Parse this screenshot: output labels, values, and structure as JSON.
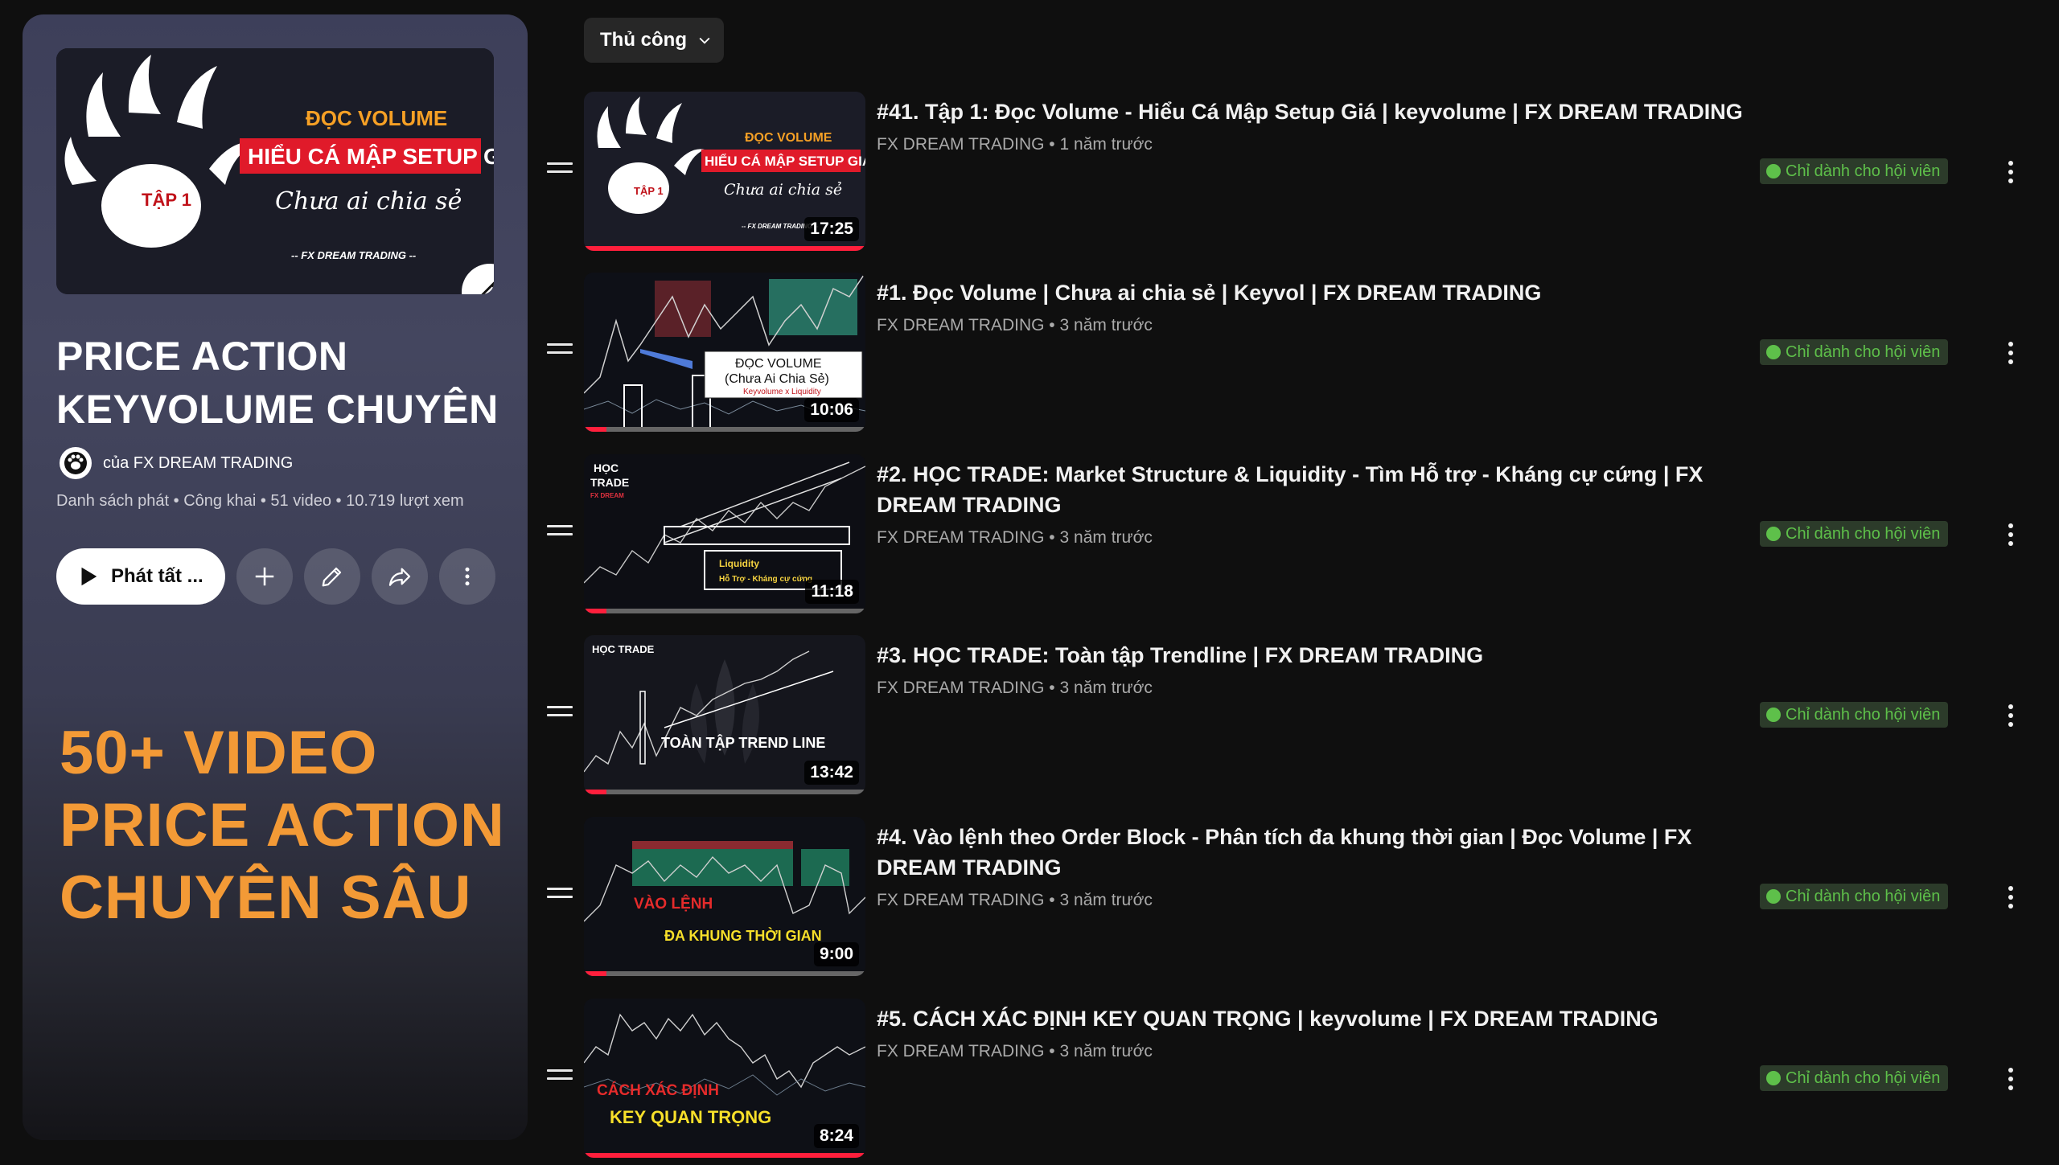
{
  "playlist": {
    "cover": {
      "line1": "ĐỌC VOLUME",
      "line2": "HIỂU CÁ MẬP SETUP GIÁ",
      "line3": "Chưa ai chia sẻ",
      "episode": "TẬP 1",
      "brand": "-- FX DREAM TRADING --"
    },
    "title_line1": "PRICE ACTION",
    "title_line2": "KEYVOLUME CHUYÊN ...",
    "owner": "của FX DREAM TRADING",
    "meta": "Danh sách phát • Công khai • 51 video • 10.719 lượt xem",
    "play_all_label": "Phát tất ...",
    "promo": [
      "50+ VIDEO",
      "PRICE ACTION",
      "CHUYÊN SÂU"
    ]
  },
  "sort": {
    "label": "Thủ công"
  },
  "videos": [
    {
      "title": "#41. Tập 1: Đọc Volume - Hiểu Cá Mập Setup Giá | keyvolume | FX DREAM TRADING",
      "channel": "FX DREAM TRADING",
      "age": "1 năm trước",
      "duration": "17:25",
      "badge": "Chỉ dành cho hội viên",
      "progress": 1.0,
      "thumb_texts": [
        "ĐỌC VOLUME",
        "HIỂU CÁ MẬP SETUP GIÁ",
        "Chưa ai chia sẻ",
        "TẬP 1",
        "-- FX DREAM TRADING --"
      ]
    },
    {
      "title": "#1. Đọc Volume | Chưa ai chia sẻ | Keyvol | FX DREAM TRADING",
      "channel": "FX DREAM TRADING",
      "age": "3 năm trước",
      "duration": "10:06",
      "badge": "Chỉ dành cho hội viên",
      "progress": 0.08,
      "thumb_texts": [
        "ĐỌC VOLUME",
        "(Chưa Ai Chia Sẻ)",
        "Keyvolume x Liquidity"
      ]
    },
    {
      "title": "#2. HỌC TRADE: Market Structure & Liquidity - Tìm Hỗ trợ - Kháng cự cứng | FX DREAM TRADING",
      "channel": "FX DREAM TRADING",
      "age": "3 năm trước",
      "duration": "11:18",
      "badge": "Chỉ dành cho hội viên",
      "progress": 0.08,
      "thumb_texts": [
        "HỌC",
        "TRADE",
        "FX DREAM",
        "Liquidity",
        "Hỗ Trợ - Kháng cự cứng"
      ]
    },
    {
      "title": "#3. HỌC TRADE: Toàn tập Trendline | FX DREAM TRADING",
      "channel": "FX DREAM TRADING",
      "age": "3 năm trước",
      "duration": "13:42",
      "badge": "Chỉ dành cho hội viên",
      "progress": 0.08,
      "thumb_texts": [
        "HỌC TRADE",
        "TOÀN TẬP TREND LINE"
      ]
    },
    {
      "title": "#4. Vào lệnh theo Order Block - Phân tích đa khung thời gian | Đọc Volume | FX DREAM TRADING",
      "channel": "FX DREAM TRADING",
      "age": "3 năm trước",
      "duration": "9:00",
      "badge": "Chỉ dành cho hội viên",
      "progress": 0.08,
      "thumb_texts": [
        "VÀO LỆNH",
        "ĐA KHUNG THỜI GIAN"
      ]
    },
    {
      "title": "#5. CÁCH XÁC ĐỊNH KEY QUAN TRỌNG | keyvolume | FX DREAM TRADING",
      "channel": "FX DREAM TRADING",
      "age": "3 năm trước",
      "duration": "8:24",
      "badge": "Chỉ dành cho hội viên",
      "progress": 1.0,
      "thumb_texts": [
        "CÁCH XÁC ĐỊNH",
        "KEY QUAN TRỌNG"
      ]
    }
  ]
}
